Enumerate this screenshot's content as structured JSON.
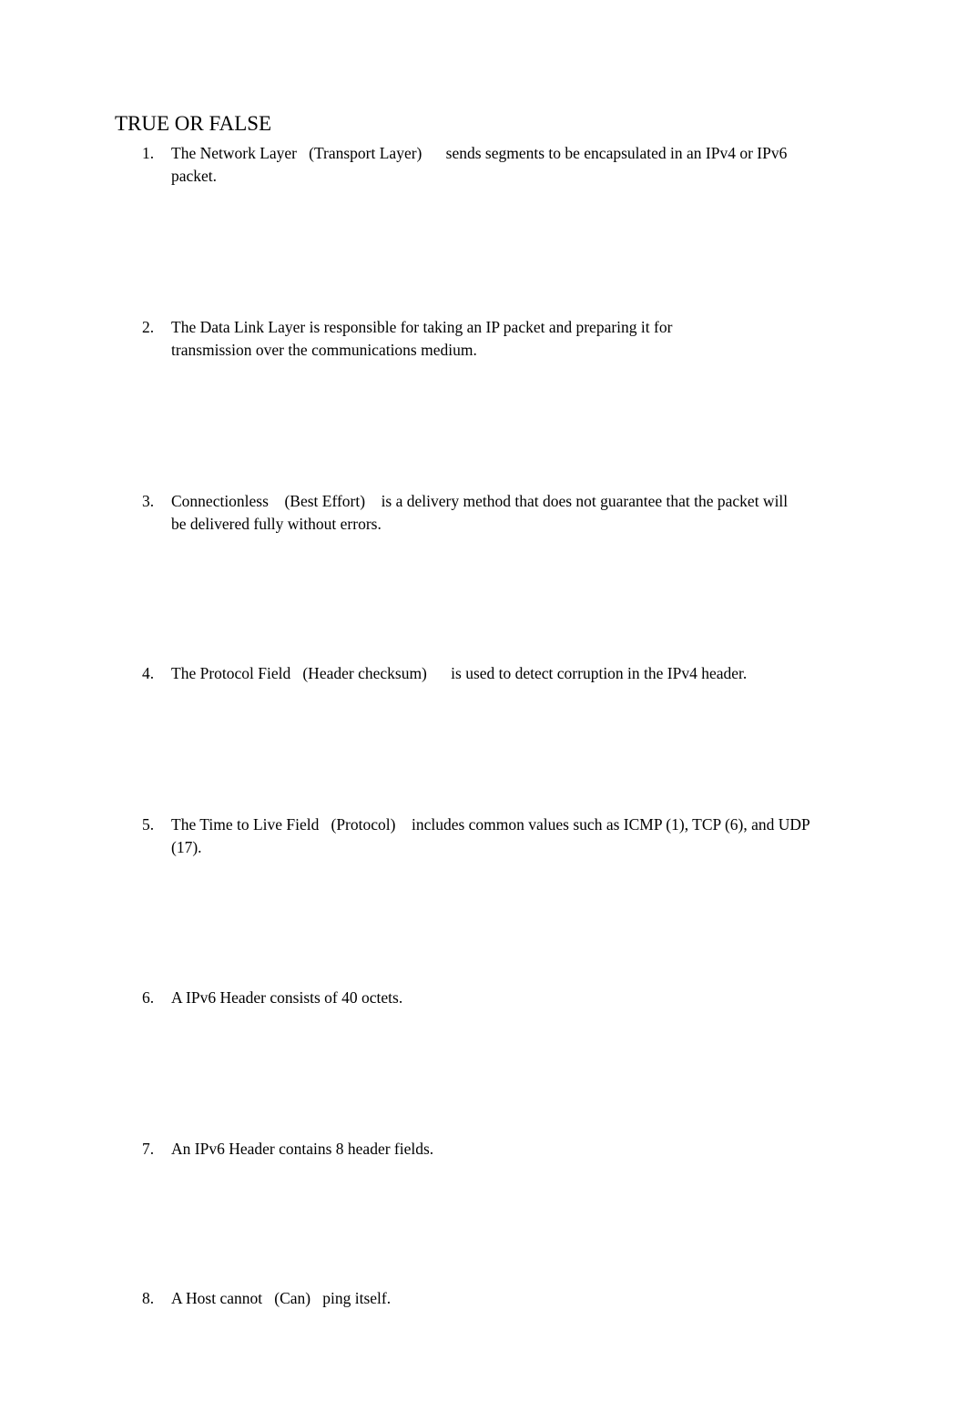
{
  "heading": "TRUE OR FALSE",
  "items": [
    {
      "number": "1.",
      "parts": [
        "The  Network Layer",
        "(Transport Layer)",
        "sends segments to be encapsulated in an IPv4 or IPv6 packet."
      ]
    },
    {
      "number": "2.",
      "text": "The Data Link Layer is responsible for taking an IP packet and preparing it for transmission over the communications medium."
    },
    {
      "number": "3.",
      "parts": [
        "Connectionless",
        "(Best Effort)",
        "is a delivery method that does not guarantee that the packet will be delivered fully without errors."
      ]
    },
    {
      "number": "4.",
      "parts": [
        "The  Protocol Field",
        "(Header checksum)",
        "is used to detect corruption in the IPv4 header."
      ]
    },
    {
      "number": "5.",
      "parts": [
        "The  Time to Live Field",
        "(Protocol)",
        "includes common values such as ICMP (1), TCP (6), and UDP (17)."
      ]
    },
    {
      "number": "6.",
      "text": "A IPv6 Header consists of 40 octets."
    },
    {
      "number": "7.",
      "text": "An IPv6 Header contains 8 header fields."
    },
    {
      "number": "8.",
      "parts": [
        "A Host  cannot",
        "(Can)",
        "ping itself."
      ]
    }
  ]
}
